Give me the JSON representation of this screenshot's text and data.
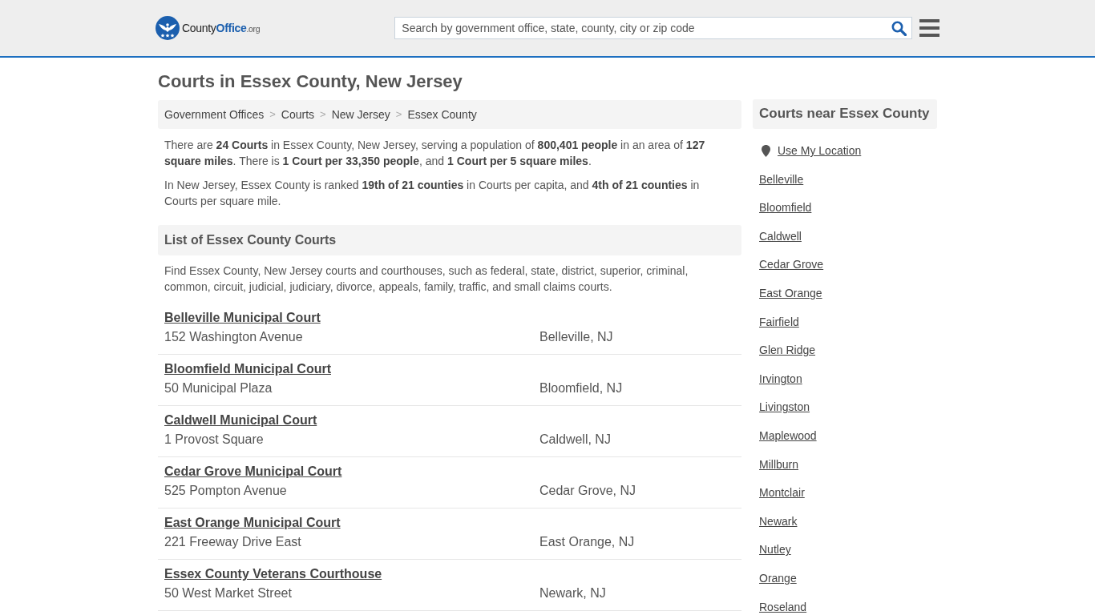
{
  "header": {
    "logo": {
      "word": "County",
      "brand": "Office",
      "domain": ".org"
    },
    "search": {
      "placeholder": "Search by government office, state, county, city or zip code"
    }
  },
  "page_title": "Courts in Essex County, New Jersey",
  "breadcrumb": {
    "separator": ">",
    "items": [
      "Government Offices",
      "Courts",
      "New Jersey",
      "Essex County"
    ]
  },
  "summary": [
    "There are **24 Courts** in Essex County, New Jersey, serving a population of **800,401 people** in an area of **127 square miles**. There is **1 Court per 33,350 people**, and **1 Court per 5 square miles**.",
    "In New Jersey, Essex County is ranked **19th of 21 counties** in Courts per capita, and **4th of 21 counties** in Courts per square mile."
  ],
  "court_list": {
    "heading": "List of Essex County Courts",
    "intro": "Find Essex County, New Jersey courts and courthouses, such as federal, state, district, superior, criminal, common, circuit, judicial, judiciary, divorce, appeals, family, traffic, and small claims courts.",
    "courts": [
      {
        "name": "Belleville Municipal Court",
        "address": "152 Washington Avenue",
        "city": "Belleville, NJ"
      },
      {
        "name": "Bloomfield Municipal Court",
        "address": "50 Municipal Plaza",
        "city": "Bloomfield, NJ"
      },
      {
        "name": "Caldwell Municipal Court",
        "address": "1 Provost Square",
        "city": "Caldwell, NJ"
      },
      {
        "name": "Cedar Grove Municipal Court",
        "address": "525 Pompton Avenue",
        "city": "Cedar Grove, NJ"
      },
      {
        "name": "East Orange Municipal Court",
        "address": "221 Freeway Drive East",
        "city": "East Orange, NJ"
      },
      {
        "name": "Essex County Veterans Courthouse",
        "address": "50 West Market Street",
        "city": "Newark, NJ"
      }
    ]
  },
  "sidebar": {
    "heading": "Courts near Essex County",
    "location_link": "Use My Location",
    "links": [
      "Belleville",
      "Bloomfield",
      "Caldwell",
      "Cedar Grove",
      "East Orange",
      "Fairfield",
      "Glen Ridge",
      "Irvington",
      "Livingston",
      "Maplewood",
      "Millburn",
      "Montclair",
      "Newark",
      "Nutley",
      "Orange",
      "Roseland"
    ]
  }
}
